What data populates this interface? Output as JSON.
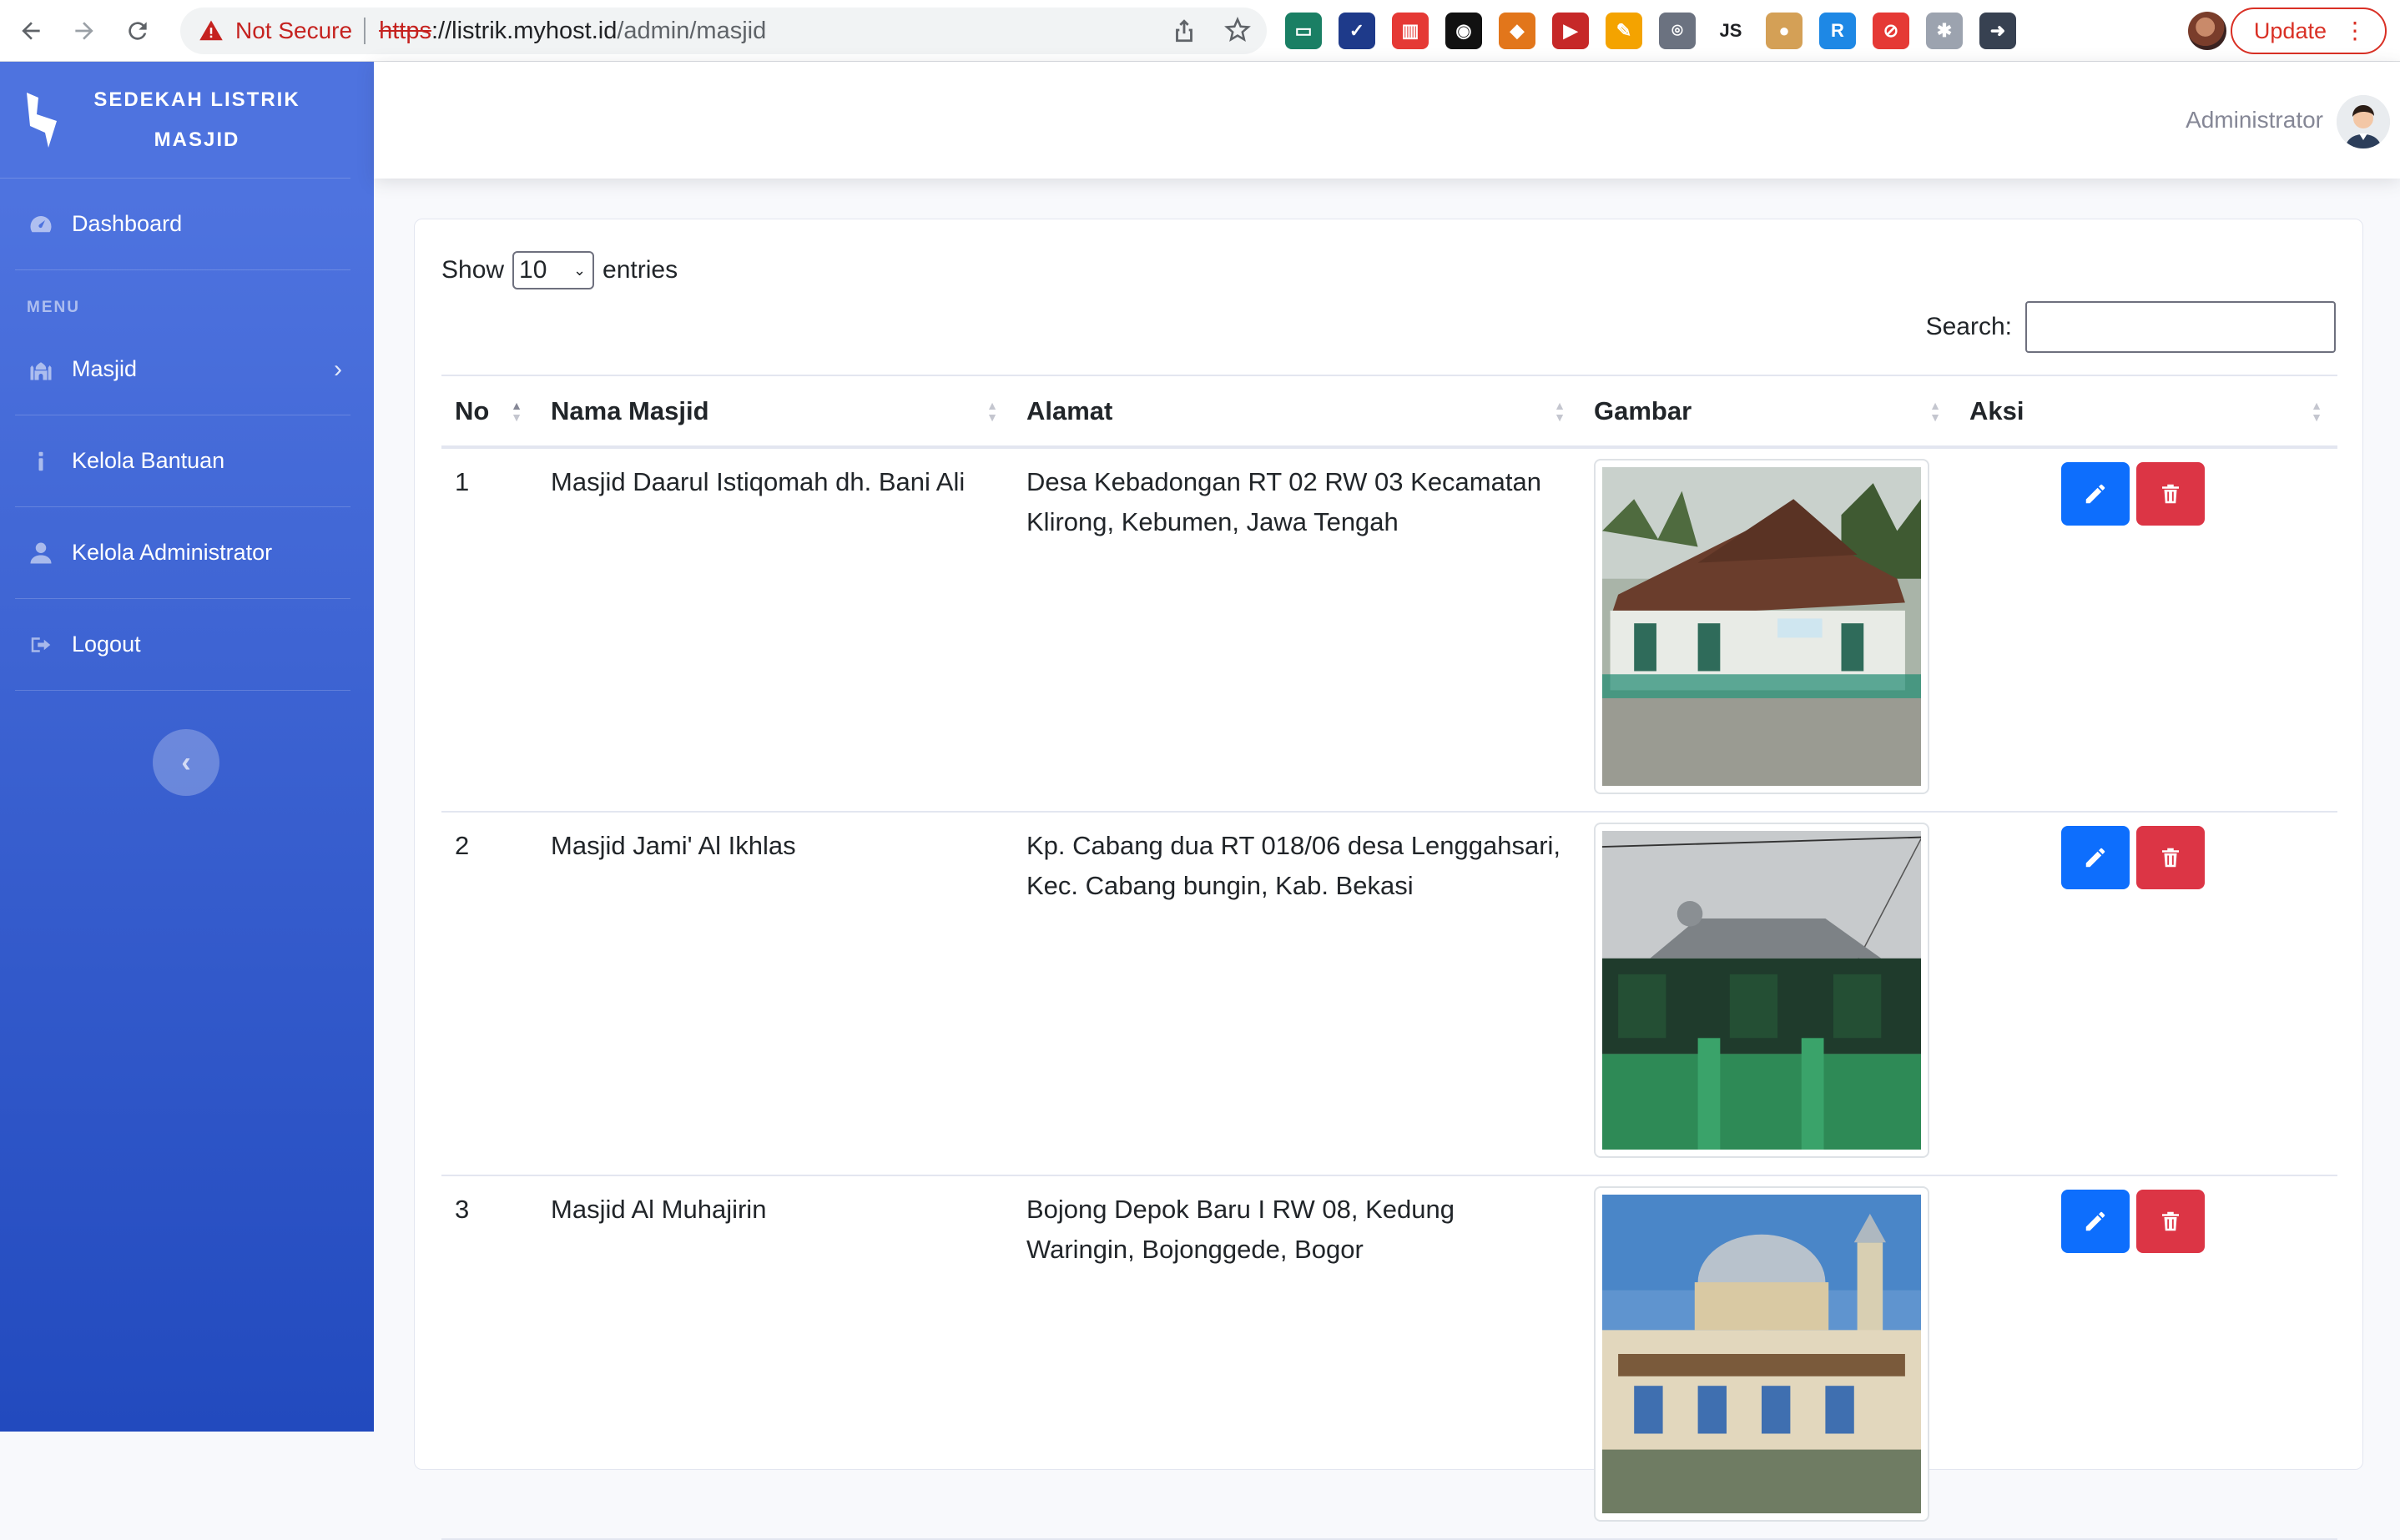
{
  "browser": {
    "security_label": "Not Secure",
    "url_scheme": "https",
    "url_host": "://listrik.myhost.id",
    "url_path": "/admin/masjid",
    "update_label": "Update",
    "extensions": [
      {
        "name": "monitor-ext-icon",
        "color": "#1a7f64",
        "glyph": "▭"
      },
      {
        "name": "check-ext-icon",
        "color": "#1e3a8a",
        "glyph": "✓"
      },
      {
        "name": "audio-ext-icon",
        "color": "#e53935",
        "glyph": "▥"
      },
      {
        "name": "glasses-ext-icon",
        "color": "#111111",
        "glyph": "◉"
      },
      {
        "name": "metamask-ext-icon",
        "color": "#e2761b",
        "glyph": "◆"
      },
      {
        "name": "video-ext-icon",
        "color": "#c62828",
        "glyph": "▶"
      },
      {
        "name": "wand-ext-icon",
        "color": "#f4a300",
        "glyph": "✎"
      },
      {
        "name": "scan-ext-icon",
        "color": "#6b7280",
        "glyph": "⌾"
      },
      {
        "name": "js-ext-icon",
        "color": "#ffffff",
        "glyph": "JS"
      },
      {
        "name": "cookie-ext-icon",
        "color": "#d4a056",
        "glyph": "●"
      },
      {
        "name": "react-ext-icon",
        "color": "#1e88e5",
        "glyph": "R"
      },
      {
        "name": "ad-ext-icon",
        "color": "#e53935",
        "glyph": "⊘"
      },
      {
        "name": "gear-ext-icon",
        "color": "#9ca3af",
        "glyph": "✱"
      },
      {
        "name": "arrow-ext-icon",
        "color": "#374151",
        "glyph": "➜"
      }
    ]
  },
  "sidebar": {
    "brand_line1": "SEDEKAH LISTRIK",
    "brand_line2": "MASJID",
    "dashboard_label": "Dashboard",
    "menu_heading": "MENU",
    "items": [
      {
        "label": "Masjid",
        "icon": "mosque-icon"
      },
      {
        "label": "Kelola Bantuan",
        "icon": "info-icon"
      },
      {
        "label": "Kelola Administrator",
        "icon": "user-icon"
      },
      {
        "label": "Logout",
        "icon": "logout-icon"
      }
    ],
    "toggle_glyph": "‹"
  },
  "topbar": {
    "user_name": "Administrator"
  },
  "datatable": {
    "show_label": "Show",
    "page_size": "10",
    "entries_label": "entries",
    "search_label": "Search:",
    "search_value": "",
    "columns": [
      "No",
      "Nama Masjid",
      "Alamat",
      "Gambar",
      "Aksi"
    ],
    "rows": [
      {
        "no": "1",
        "nama": "Masjid Daarul Istiqomah dh. Bani Ali",
        "alamat": "Desa Kebadongan RT 02 RW 03 Kecamatan Klirong, Kebumen, Jawa Tengah"
      },
      {
        "no": "2",
        "nama": "Masjid Jami' Al Ikhlas",
        "alamat": "Kp. Cabang dua RT 018/06 desa Lenggahsari, Kec. Cabang bungin, Kab. Bekasi"
      },
      {
        "no": "3",
        "nama": "Masjid Al Muhajirin",
        "alamat": "Bojong Depok Baru I RW 08, Kedung Waringin, Bojonggede, Bogor"
      }
    ]
  },
  "colors": {
    "sidebar_top": "#4e73df",
    "sidebar_bottom": "#224abe",
    "edit_button": "#0d6efd",
    "delete_button": "#dc3545"
  }
}
